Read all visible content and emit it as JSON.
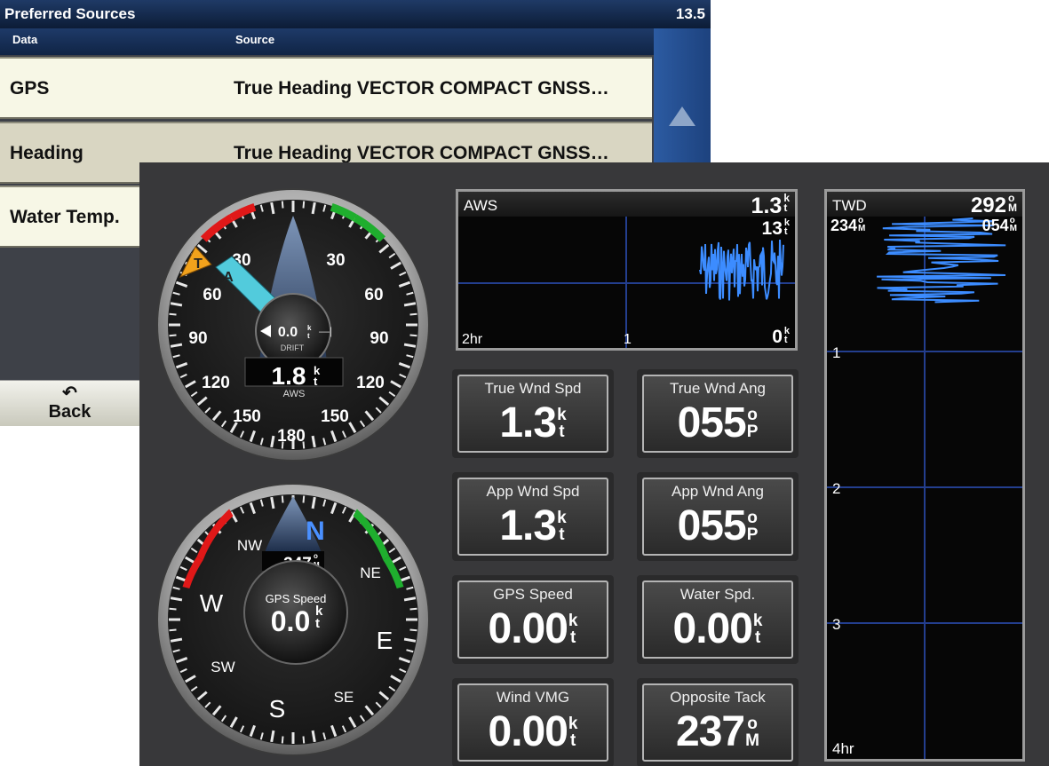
{
  "preferred_sources": {
    "title": "Preferred Sources",
    "corner_value": "13.5",
    "columns": {
      "data": "Data",
      "source": "Source"
    },
    "rows": [
      {
        "data": "GPS",
        "source": "True Heading VECTOR COMPACT GNSS…"
      },
      {
        "data": "Heading",
        "source": "True Heading VECTOR COMPACT GNSS…"
      },
      {
        "data": "Water Temp.",
        "source": ""
      }
    ],
    "back_label": "Back",
    "back_icon": "return-arrow-icon"
  },
  "wind_gauge": {
    "scale": {
      "top_left": "30",
      "top_right": "30",
      "mid_left": "60",
      "mid_right": "60",
      "left": "90",
      "right": "90",
      "low_left": "120",
      "low_right": "120",
      "bottom_left": "150",
      "bottom_right": "150",
      "bottom": "180"
    },
    "markers": {
      "true_label": "T",
      "apparent_label": "A"
    },
    "drift_value": "0.0",
    "drift_label": "DRIFT",
    "aws_value": "1.8",
    "aws_label": "AWS",
    "unit_top": "k",
    "unit_bottom": "t",
    "colors": {
      "port": "#e01818",
      "starboard": "#1fae2e",
      "true_marker": "#f2a21c",
      "apparent_marker": "#52cbdc"
    }
  },
  "compass_gauge": {
    "n": "N",
    "ne": "NE",
    "e": "E",
    "se": "SE",
    "s": "S",
    "sw": "SW",
    "w": "W",
    "nw": "NW",
    "heading_value": "347",
    "heading_unit_top": "o",
    "heading_unit_bottom": "M",
    "speed_label": "GPS Speed",
    "speed_value": "0.0",
    "unit_top": "k",
    "unit_bottom": "t"
  },
  "aws_graph": {
    "title": "AWS",
    "value": "1.3",
    "max_label": "13",
    "min_label": "0",
    "time_left": "2hr",
    "time_mid": "1",
    "unit_top": "k",
    "unit_bottom": "t",
    "series_color": "#3c8cff"
  },
  "twd_graph": {
    "title": "TWD",
    "value": "292",
    "left_label": "234",
    "right_label": "054",
    "time_1": "1",
    "time_2": "2",
    "time_3": "3",
    "time_end": "4hr",
    "unit_top": "o",
    "unit_bottom": "M",
    "series_color": "#3c8cff"
  },
  "tiles": [
    {
      "label": "True Wnd Spd",
      "value": "1.3",
      "unit_top": "k",
      "unit_bottom": "t"
    },
    {
      "label": "True Wnd Ang",
      "value": "055",
      "unit_top": "o",
      "unit_bottom": "P"
    },
    {
      "label": "App Wnd Spd",
      "value": "1.3",
      "unit_top": "k",
      "unit_bottom": "t"
    },
    {
      "label": "App Wnd Ang",
      "value": "055",
      "unit_top": "o",
      "unit_bottom": "P"
    },
    {
      "label": "GPS Speed",
      "value": "0.00",
      "unit_top": "k",
      "unit_bottom": "t"
    },
    {
      "label": "Water Spd.",
      "value": "0.00",
      "unit_top": "k",
      "unit_bottom": "t"
    },
    {
      "label": "Wind VMG",
      "value": "0.00",
      "unit_top": "k",
      "unit_bottom": "t"
    },
    {
      "label": "Opposite Tack",
      "value": "237",
      "unit_top": "o",
      "unit_bottom": "M"
    }
  ]
}
